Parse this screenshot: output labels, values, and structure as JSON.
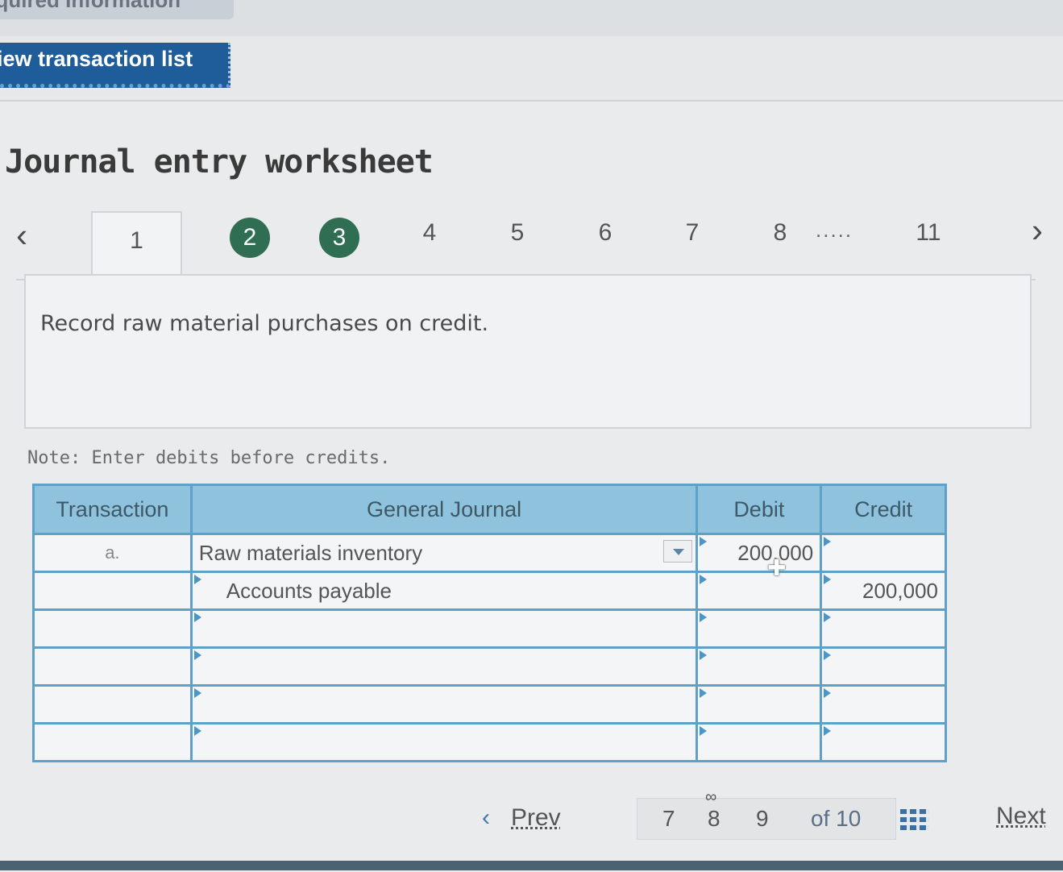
{
  "header": {
    "required_tab_label": "equired Information",
    "view_button_label": "iew transaction list"
  },
  "worksheet": {
    "title": "Journal entry worksheet",
    "tabs": [
      "1",
      "2",
      "3",
      "4",
      "5",
      "6",
      "7",
      "8",
      "11"
    ],
    "tabs_ellipsis": ".....",
    "description": "Record raw material purchases on credit.",
    "note": "Note: Enter debits before credits."
  },
  "table": {
    "headers": {
      "transaction": "Transaction",
      "general_journal": "General Journal",
      "debit": "Debit",
      "credit": "Credit"
    },
    "rows": [
      {
        "transaction": "a.",
        "account": "Raw materials inventory",
        "debit": "200,000",
        "credit": ""
      },
      {
        "transaction": "",
        "account": "Accounts payable",
        "debit": "",
        "credit": "200,000"
      },
      {
        "transaction": "",
        "account": "",
        "debit": "",
        "credit": ""
      },
      {
        "transaction": "",
        "account": "",
        "debit": "",
        "credit": ""
      },
      {
        "transaction": "",
        "account": "",
        "debit": "",
        "credit": ""
      },
      {
        "transaction": "",
        "account": "",
        "debit": "",
        "credit": ""
      }
    ]
  },
  "footer": {
    "prev_label": "Prev",
    "pages": [
      "7",
      "8",
      "9"
    ],
    "of_label": "of 10",
    "next_label": "Next"
  },
  "colors": {
    "header_blue": "#1f5d9a",
    "table_header": "#8fc3dd",
    "table_border": "#5fa0c8",
    "completed_tab": "#2f6e52"
  }
}
